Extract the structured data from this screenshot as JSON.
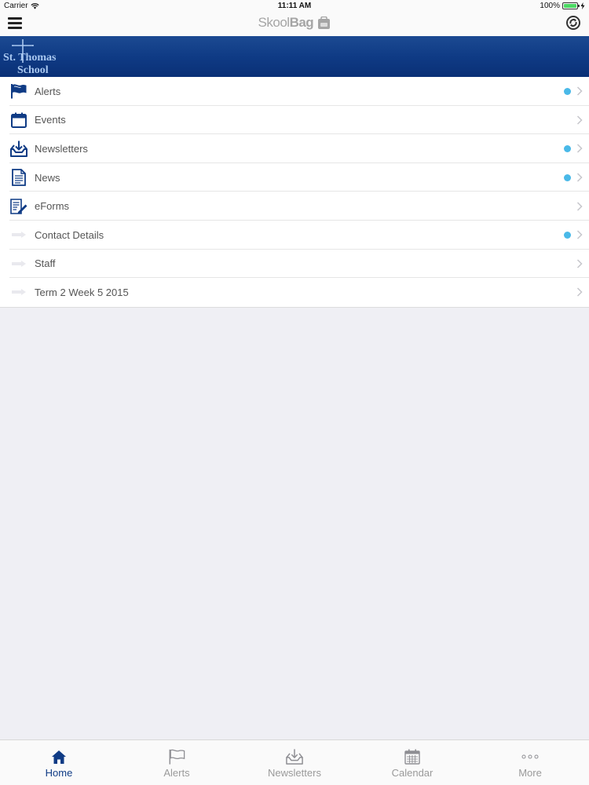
{
  "status_bar": {
    "carrier": "Carrier",
    "time": "11:11 AM",
    "battery": "100%"
  },
  "nav": {
    "title_light": "Skool",
    "title_bold": "Bag"
  },
  "banner": {
    "school_line1": "St. Thomas",
    "school_line2": "School",
    "color": "#0f3b85"
  },
  "menu": {
    "items": [
      {
        "label": "Alerts",
        "icon": "flag-icon",
        "unread": true
      },
      {
        "label": "Events",
        "icon": "calendar-icon",
        "unread": false
      },
      {
        "label": "Newsletters",
        "icon": "inbox-download-icon",
        "unread": true
      },
      {
        "label": "News",
        "icon": "document-icon",
        "unread": true
      },
      {
        "label": "eForms",
        "icon": "form-edit-icon",
        "unread": false
      },
      {
        "label": "Contact Details",
        "icon": "placeholder-icon",
        "unread": true
      },
      {
        "label": "Staff",
        "icon": "placeholder-icon",
        "unread": false
      },
      {
        "label": "Term 2 Week 5 2015",
        "icon": "placeholder-icon",
        "unread": false
      }
    ],
    "unread_color": "#4ab9e8"
  },
  "tab_bar": {
    "tabs": [
      {
        "label": "Home",
        "icon": "home-icon",
        "active": true
      },
      {
        "label": "Alerts",
        "icon": "flag-icon",
        "active": false
      },
      {
        "label": "Newsletters",
        "icon": "inbox-download-icon",
        "active": false
      },
      {
        "label": "Calendar",
        "icon": "calendar-icon",
        "active": false
      },
      {
        "label": "More",
        "icon": "more-dots-icon",
        "active": false
      }
    ],
    "active_color": "#0f3b85"
  }
}
